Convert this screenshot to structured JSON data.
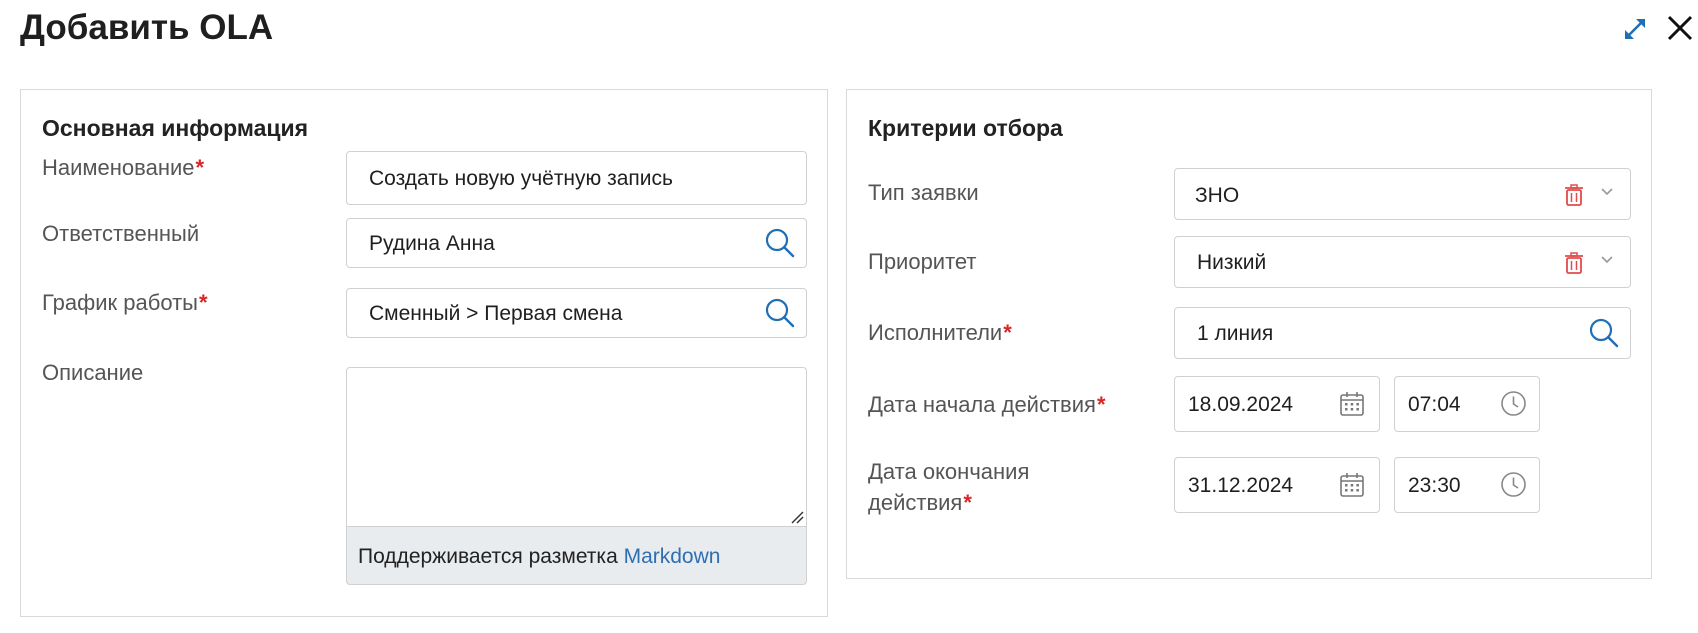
{
  "header": {
    "title": "Добавить OLA"
  },
  "left_panel": {
    "title": "Основная информация",
    "name": {
      "label": "Наименование",
      "required": "*",
      "value": "Создать новую учётную запись"
    },
    "responsible": {
      "label": "Ответственный",
      "value": "Рудина Анна"
    },
    "schedule": {
      "label": "График работы",
      "required": "*",
      "value": "Сменный > Первая смена"
    },
    "description": {
      "label": "Описание",
      "value": "",
      "hint": "Поддерживается разметка ",
      "hint_link": "Markdown"
    }
  },
  "right_panel": {
    "title": "Критерии отбора",
    "request_type": {
      "label": "Тип заявки",
      "value": "ЗНО"
    },
    "priority": {
      "label": "Приоритет",
      "value": "Низкий"
    },
    "executors": {
      "label": "Исполнители",
      "required": "*",
      "value": "1 линия"
    },
    "start": {
      "label": "Дата начала действия",
      "required": "*",
      "date": "18.09.2024",
      "time": "07:04"
    },
    "end": {
      "label_line1": "Дата окончания",
      "label_line2": "действия",
      "required": "*",
      "date": "31.12.2024",
      "time": "23:30"
    }
  },
  "colors": {
    "accent": "#1f6fb5",
    "required": "#d92525",
    "trash": "#e24b4b",
    "link": "#2f6fb0"
  },
  "icons": [
    "expand-icon",
    "close-icon",
    "search-icon",
    "trash-icon",
    "chevron-down-icon",
    "calendar-icon",
    "clock-icon"
  ]
}
